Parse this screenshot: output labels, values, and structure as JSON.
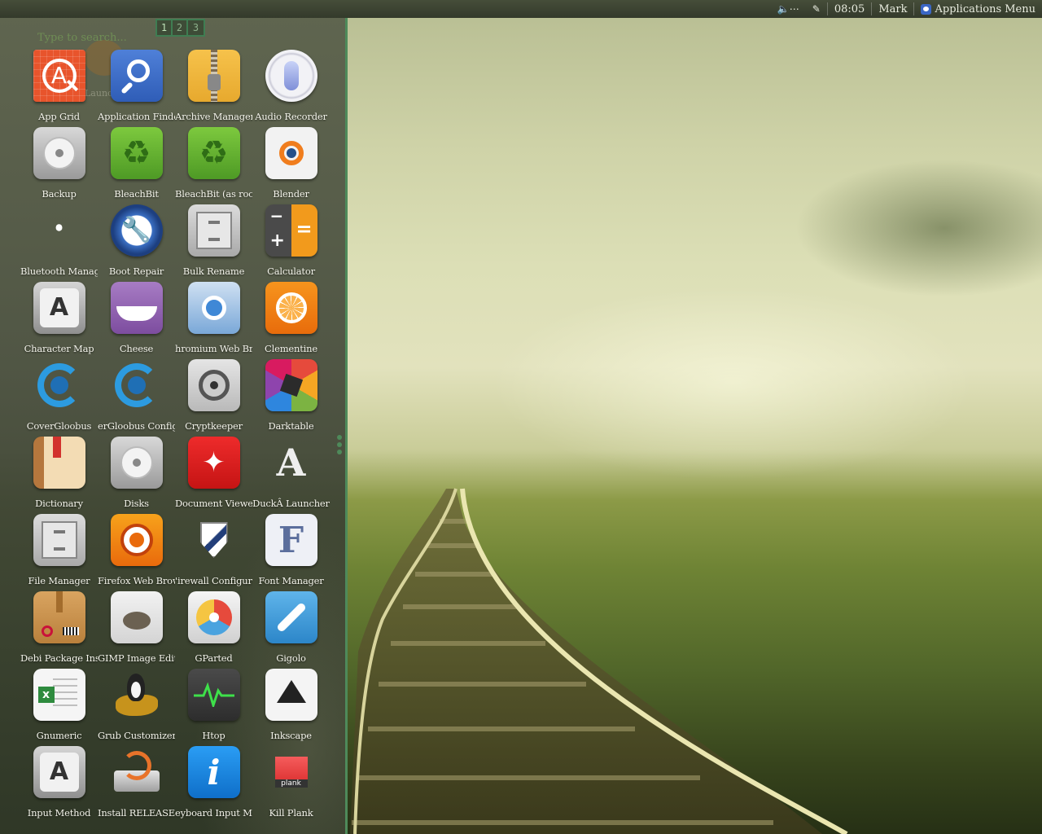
{
  "panel": {
    "clock": "08:05",
    "user": "Mark",
    "menu_label": "Applications Menu"
  },
  "launcher": {
    "search_placeholder": "Type to search...",
    "ghost_text": "Launch",
    "pages": [
      "1",
      "2",
      "3"
    ],
    "apps": [
      {
        "label": "App Grid",
        "icon": "app-grid-icon"
      },
      {
        "label": "Application Finder",
        "icon": "magnifier-icon"
      },
      {
        "label": "Archive Manager",
        "icon": "zipper-icon"
      },
      {
        "label": "Audio Recorder",
        "icon": "microphone-icon"
      },
      {
        "label": "Backup",
        "icon": "hard-disk-icon"
      },
      {
        "label": "BleachBit",
        "icon": "recycle-icon"
      },
      {
        "label": "BleachBit (as root)",
        "icon": "recycle-icon"
      },
      {
        "label": "Blender",
        "icon": "blender-icon"
      },
      {
        "label": "Bluetooth Manager",
        "icon": "bluetooth-icon"
      },
      {
        "label": "Boot Repair",
        "icon": "wrench-icon"
      },
      {
        "label": "Bulk Rename",
        "icon": "file-cabinet-icon"
      },
      {
        "label": "Calculator",
        "icon": "calculator-icon"
      },
      {
        "label": "Character Map",
        "icon": "letter-a-key-icon"
      },
      {
        "label": "Cheese",
        "icon": "grin-icon"
      },
      {
        "label": "hromium Web Browse",
        "icon": "chromium-icon"
      },
      {
        "label": "Clementine",
        "icon": "orange-slice-icon"
      },
      {
        "label": "CoverGloobus",
        "icon": "swirl-icon"
      },
      {
        "label": "erGloobus Configurat",
        "icon": "swirl-icon"
      },
      {
        "label": "Cryptkeeper",
        "icon": "vault-icon"
      },
      {
        "label": "Darktable",
        "icon": "aperture-icon"
      },
      {
        "label": "Dictionary",
        "icon": "book-icon"
      },
      {
        "label": "Disks",
        "icon": "hard-disk-icon"
      },
      {
        "label": "Document Viewer",
        "icon": "pdf-icon"
      },
      {
        "label": "DuckÂ Launcher",
        "icon": "letter-a-icon"
      },
      {
        "label": "File Manager",
        "icon": "file-cabinet-icon"
      },
      {
        "label": "Firefox Web Browser",
        "icon": "firefox-icon"
      },
      {
        "label": "'irewall Configuratior",
        "icon": "shield-icon"
      },
      {
        "label": "Font Manager",
        "icon": "letter-f-icon"
      },
      {
        "label": "Debi Package Installe",
        "icon": "package-box-icon"
      },
      {
        "label": "GIMP Image Editor",
        "icon": "gimp-icon"
      },
      {
        "label": "GParted",
        "icon": "disc-icon"
      },
      {
        "label": "Gigolo",
        "icon": "plug-icon"
      },
      {
        "label": "Gnumeric",
        "icon": "spreadsheet-icon"
      },
      {
        "label": "Grub Customizer",
        "icon": "tux-icon"
      },
      {
        "label": "Htop",
        "icon": "heartbeat-icon"
      },
      {
        "label": "Inkscape",
        "icon": "inkscape-icon"
      },
      {
        "label": "Input Method",
        "icon": "letter-a-key-icon"
      },
      {
        "label": "Install RELEASE",
        "icon": "installer-icon"
      },
      {
        "label": "eyboard Input Methoi",
        "icon": "info-icon"
      },
      {
        "label": "Kill Plank",
        "icon": "plank-icon"
      }
    ]
  },
  "icon_texts": {
    "plank_word": "plank"
  },
  "colors": {
    "panel_bg": "#363d2c",
    "launcher_border": "#4e8a5a",
    "accent_blue": "#3b67c4"
  }
}
